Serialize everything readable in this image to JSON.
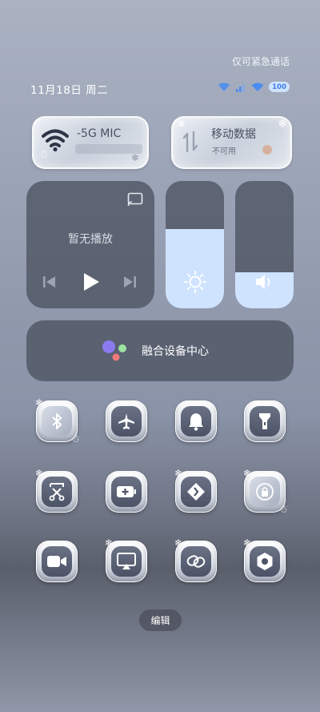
{
  "status_bar": {
    "emergency_text": "仅可紧急通话",
    "date": "11月18日 周二",
    "battery": "100"
  },
  "tiles": {
    "wifi": {
      "label": "-5G  MIC",
      "icon": "wifi-icon"
    },
    "mobile_data": {
      "title": "移动数据",
      "subtitle": "不可用",
      "icon": "mobile-data-icon"
    }
  },
  "media": {
    "status": "暂无播放"
  },
  "sliders": {
    "brightness_level": 0.62,
    "volume_level": 0.28
  },
  "fusion": {
    "label": "融合设备中心"
  },
  "toggles": [
    {
      "name": "bluetooth",
      "icon": "bluetooth-icon"
    },
    {
      "name": "airplane-mode",
      "icon": "airplane-icon"
    },
    {
      "name": "ring-mode",
      "icon": "bell-icon"
    },
    {
      "name": "flashlight",
      "icon": "flashlight-icon"
    },
    {
      "name": "screenshot",
      "icon": "scissors-icon"
    },
    {
      "name": "battery-saver",
      "icon": "battery-plus-icon"
    },
    {
      "name": "nfc",
      "icon": "nfc-icon"
    },
    {
      "name": "rotation-lock",
      "icon": "lock-rotate-icon"
    },
    {
      "name": "screen-record",
      "icon": "video-icon"
    },
    {
      "name": "screen-cast",
      "icon": "cast-icon"
    },
    {
      "name": "hotspot-link",
      "icon": "link-icon"
    },
    {
      "name": "settings",
      "icon": "settings-icon"
    }
  ],
  "edit": {
    "label": "编辑"
  },
  "colors": {
    "accent": "#cfe3ff",
    "battery_text": "#3f7ee8"
  }
}
